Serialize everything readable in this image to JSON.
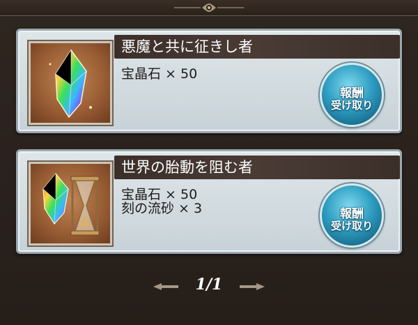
{
  "missions": [
    {
      "title": "悪魔と共に征きし者",
      "icon": "rainbow-crystal-icon",
      "rewards": [
        {
          "item": "宝晶石",
          "qty": "× 50"
        }
      ],
      "claim": {
        "line1": "報酬",
        "line2": "受け取り"
      }
    },
    {
      "title": "世界の胎動を阻む者",
      "icon": "crystal-and-hourglass-icon",
      "rewards": [
        {
          "item": "宝晶石",
          "qty": "× 50"
        },
        {
          "item": "刻の流砂",
          "qty": "× 3"
        }
      ],
      "claim": {
        "line1": "報酬",
        "line2": "受け取り"
      }
    }
  ],
  "pager": {
    "text": "1/1"
  },
  "colors": {
    "title_bar": "#3b2f2a",
    "panel": "#dfe6e9",
    "button": "#2f9ec2",
    "frame": "#2a221d"
  }
}
